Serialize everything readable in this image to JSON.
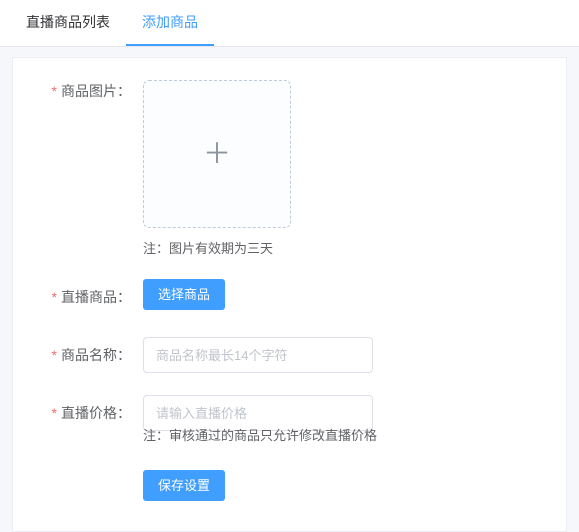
{
  "tabs": {
    "list": "直播商品列表",
    "add": "添加商品"
  },
  "form": {
    "image": {
      "label": "商品图片：",
      "note": "注：图片有效期为三天"
    },
    "product": {
      "label": "直播商品：",
      "button": "选择商品"
    },
    "name": {
      "label": "商品名称：",
      "placeholder": "商品名称最长14个字符"
    },
    "price": {
      "label": "直播价格：",
      "placeholder": "请输入直播价格",
      "note": "注：审核通过的商品只允许修改直播价格"
    },
    "submit": "保存设置"
  }
}
